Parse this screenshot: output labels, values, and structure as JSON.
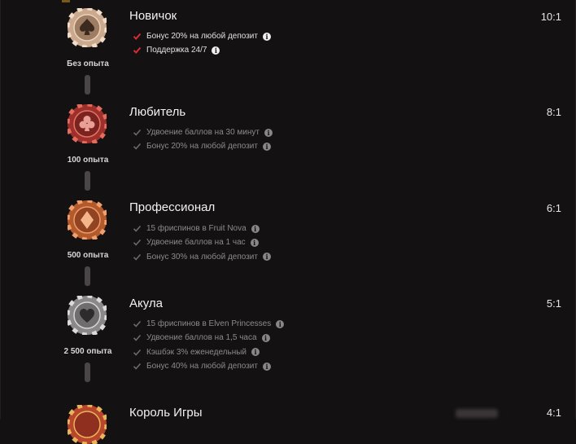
{
  "colors": {
    "background": "#141112",
    "check_active": "#d92b35",
    "check_muted": "#6e6a6b"
  },
  "levels": [
    {
      "title": "Новичок",
      "ratio": "10:1",
      "xp": "Без опыта",
      "chip_icon": "spade-icon",
      "active": true,
      "perks": [
        "Бонус 20% на любой депозит",
        "Поддержка 24/7"
      ]
    },
    {
      "title": "Любитель",
      "ratio": "8:1",
      "xp": "100 опыта",
      "chip_icon": "club-icon",
      "active": false,
      "perks": [
        "Удвоение баллов на 30 минут",
        "Бонус 20% на любой депозит"
      ]
    },
    {
      "title": "Профессионал",
      "ratio": "6:1",
      "xp": "500 опыта",
      "chip_icon": "diamond-icon",
      "active": false,
      "perks": [
        "15 фриспинов в Fruit Nova",
        "Удвоение баллов на 1 час",
        "Бонус 30% на любой депозит"
      ]
    },
    {
      "title": "Акула",
      "ratio": "5:1",
      "xp": "2 500 опыта",
      "chip_icon": "heart-icon",
      "active": false,
      "perks": [
        "15 фриспинов в Elven Princesses",
        "Удвоение баллов на 1,5 часа",
        "Кэшбэк 3% еженедельный",
        "Бонус 40% на любой депозит"
      ]
    },
    {
      "title": "Король Игры",
      "ratio": "4:1",
      "chip_icon": "chip-icon",
      "active": false
    }
  ]
}
